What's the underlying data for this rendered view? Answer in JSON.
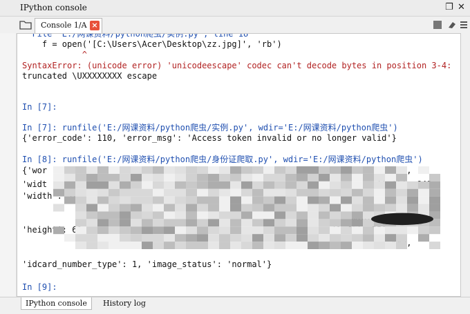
{
  "window": {
    "title": "IPython console",
    "float_btn": "❐",
    "close_btn": "✕"
  },
  "toolbar": {
    "tab_label": "Console 1/A",
    "tab_close": "×"
  },
  "console": {
    "lines": [
      {
        "text": "  File \"E:/网课资料/python爬虫/实例.py\", line 18",
        "color": "#1f4fb0"
      },
      {
        "text": "    f = open('[C:\\Users\\Acer\\Desktop\\zz.jpg]', 'rb')",
        "color": "#111111"
      },
      {
        "text": "            ^",
        "color": "#b22222"
      },
      {
        "text": "SyntaxError: (unicode error) 'unicodeescape' codec can't decode bytes in position 3-4:",
        "color": "#b22222"
      },
      {
        "text": "truncated \\UXXXXXXXX escape",
        "color": "#111111"
      },
      {
        "text": "",
        "color": "#111111"
      },
      {
        "text": "",
        "color": "#111111"
      },
      {
        "text": "In [7]:",
        "color": "#1f4fb0"
      },
      {
        "text": "",
        "color": "#111111"
      },
      {
        "text": "In [7]: runfile('E:/网课资料/python爬虫/实例.py', wdir='E:/网课资料/python爬虫')",
        "color": "#1f4fb0"
      },
      {
        "text": "{'error_code': 110, 'error_msg': 'Access token invalid or no longer valid'}",
        "color": "#111111"
      },
      {
        "text": "",
        "color": "#111111"
      },
      {
        "text": "In [8]: runfile('E:/网课资料/python爬虫/身份证爬取.py', wdir='E:/网课资料/python爬虫')",
        "color": "#1f4fb0"
      },
      {
        "text": "{'wor                                                                      28,",
        "color": "#111111"
      },
      {
        "text": "'widt                                                                  'left': 648,",
        "color": "#111111"
      },
      {
        "text": "'width': 32,",
        "color": "#111111"
      },
      {
        "text": "",
        "color": "#111111"
      },
      {
        "text": "                                                                  width': 53,",
        "color": "#111111"
      },
      {
        "text": "'height': 62                                                , 'left': 559,",
        "color": "#111111"
      },
      {
        "text": "                                                                          642,",
        "color": "#111111"
      },
      {
        "text": "'idcard_number_type': 1, 'image_status': 'normal'}",
        "color": "#111111"
      },
      {
        "text": "",
        "color": "#111111"
      },
      {
        "text": "In [9]:",
        "color": "#1f4fb0"
      }
    ]
  },
  "bottom_tabs": [
    "IPython console",
    "History log"
  ],
  "colors": {
    "prompt": "#1f4fb0",
    "error": "#b22222",
    "string": "#1e8a4a",
    "tab_close_bg": "#e8503a"
  }
}
